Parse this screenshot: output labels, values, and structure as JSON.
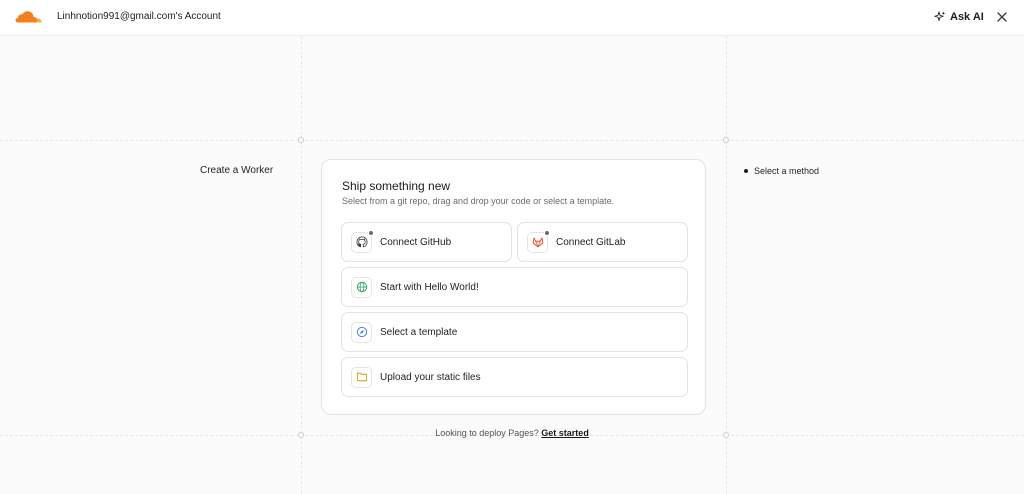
{
  "header": {
    "account": "Linhnotion991@gmail.com's Account",
    "ask_ai": "Ask AI",
    "logo_color": "#f38020"
  },
  "sidebar": {
    "left_label": "Create a Worker",
    "step_label": "Select a method"
  },
  "card": {
    "title": "Ship something new",
    "subtitle": "Select from a git repo, drag and drop your code or select a template.",
    "options": [
      {
        "label": "Connect GitHub",
        "icon": "github-icon"
      },
      {
        "label": "Connect GitLab",
        "icon": "gitlab-icon"
      },
      {
        "label": "Start with Hello World!",
        "icon": "globe-icon"
      },
      {
        "label": "Select a template",
        "icon": "compass-icon"
      },
      {
        "label": "Upload your static files",
        "icon": "folder-icon"
      }
    ]
  },
  "footer": {
    "text": "Looking to deploy Pages?",
    "link": "Get started"
  }
}
